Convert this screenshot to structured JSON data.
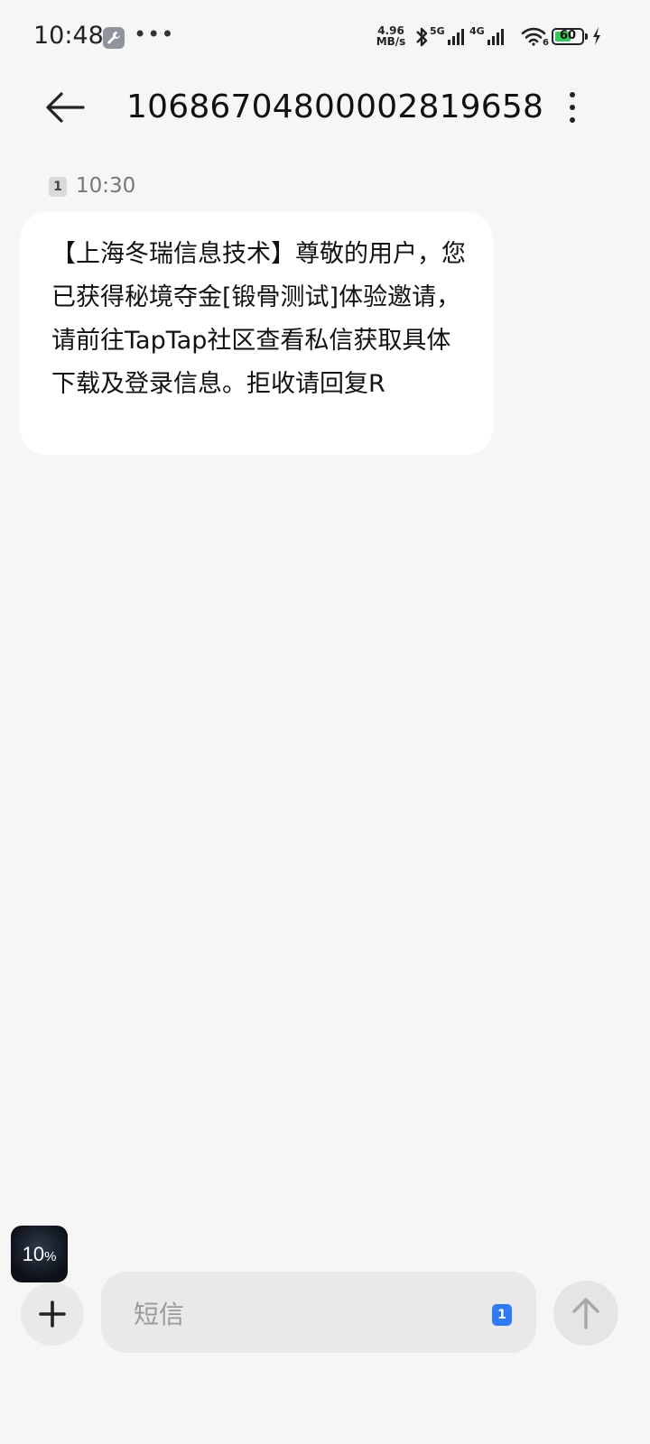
{
  "status_bar": {
    "time": "10:48",
    "net_speed_value": "4.96",
    "net_speed_unit": "MB/s",
    "sim1_tag": "5G",
    "sim2_tag": "4G",
    "wifi_label": "6",
    "battery_level": "60",
    "battery_fraction": 0.6,
    "battery_color": "#35c759",
    "icons": [
      "tool-icon",
      "more-dots-icon",
      "bluetooth-icon",
      "signal-icon",
      "wifi-icon",
      "battery-icon",
      "charging-icon"
    ]
  },
  "header": {
    "title": "10686704800002819658",
    "back_icon": "arrow-left",
    "menu_icon": "vertical-dots"
  },
  "messages": [
    {
      "sim": "1",
      "time": "10:30",
      "text": "【上海冬瑞信息技术】尊敬的用户，您已获得秘境夺金[锻骨测试]体验邀请，请前往TapTap社区查看私信获取具体下载及登录信息。拒收请回复R"
    }
  ],
  "floating_widget": {
    "value": "10",
    "unit": "%"
  },
  "composer": {
    "placeholder": "短信",
    "sim_selector": "1",
    "accent_color": "#2f7bf6",
    "add_icon": "plus",
    "send_icon": "arrow-up"
  }
}
